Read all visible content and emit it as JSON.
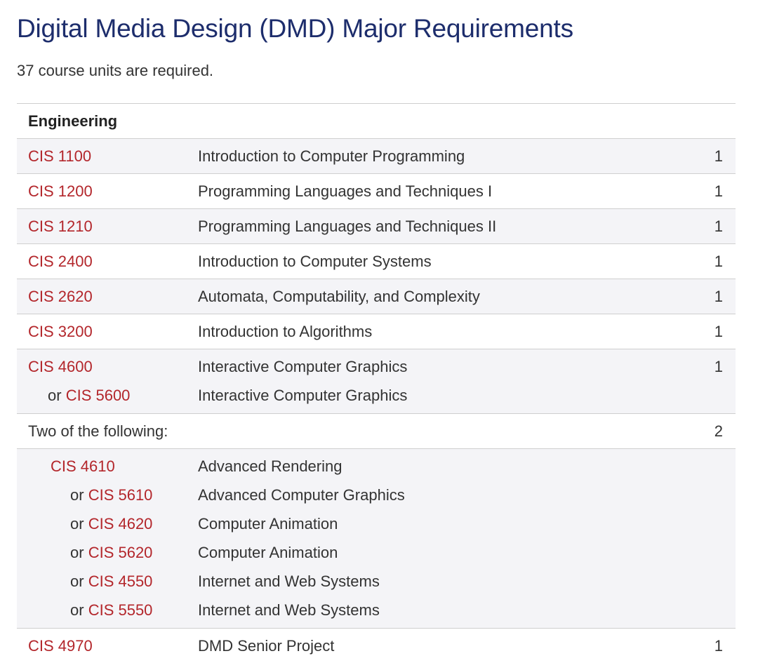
{
  "title": "Digital Media Design (DMD) Major Requirements",
  "subtitle": "37 course units are required.",
  "section": "Engineering",
  "or_word": "or",
  "courses": [
    {
      "code": "CIS 1100",
      "title": "Introduction to Computer Programming",
      "units": "1"
    },
    {
      "code": "CIS 1200",
      "title": "Programming Languages and Techniques I",
      "units": "1"
    },
    {
      "code": "CIS 1210",
      "title": "Programming Languages and Techniques II",
      "units": "1"
    },
    {
      "code": "CIS 2400",
      "title": "Introduction to Computer Systems",
      "units": "1"
    },
    {
      "code": "CIS 2620",
      "title": "Automata, Computability, and Complexity",
      "units": "1"
    },
    {
      "code": "CIS 3200",
      "title": "Introduction to Algorithms",
      "units": "1"
    }
  ],
  "graphics": {
    "code": "CIS 4600",
    "title": "Interactive Computer Graphics",
    "units": "1",
    "alt_code": "CIS 5600",
    "alt_title": "Interactive Computer Graphics"
  },
  "two_of_following": {
    "label": "Two of the following:",
    "units": "2"
  },
  "electives": [
    {
      "code": "CIS 4610",
      "title": "Advanced Rendering"
    },
    {
      "code": "CIS 5610",
      "title": "Advanced Computer Graphics"
    },
    {
      "code": "CIS 4620",
      "title": "Computer Animation"
    },
    {
      "code": "CIS 5620",
      "title": "Computer Animation"
    },
    {
      "code": "CIS 4550",
      "title": "Internet and Web Systems"
    },
    {
      "code": "CIS 5550",
      "title": "Internet and Web Systems"
    }
  ],
  "senior": {
    "code": "CIS 4970",
    "title": "DMD Senior Project",
    "units": "1"
  }
}
